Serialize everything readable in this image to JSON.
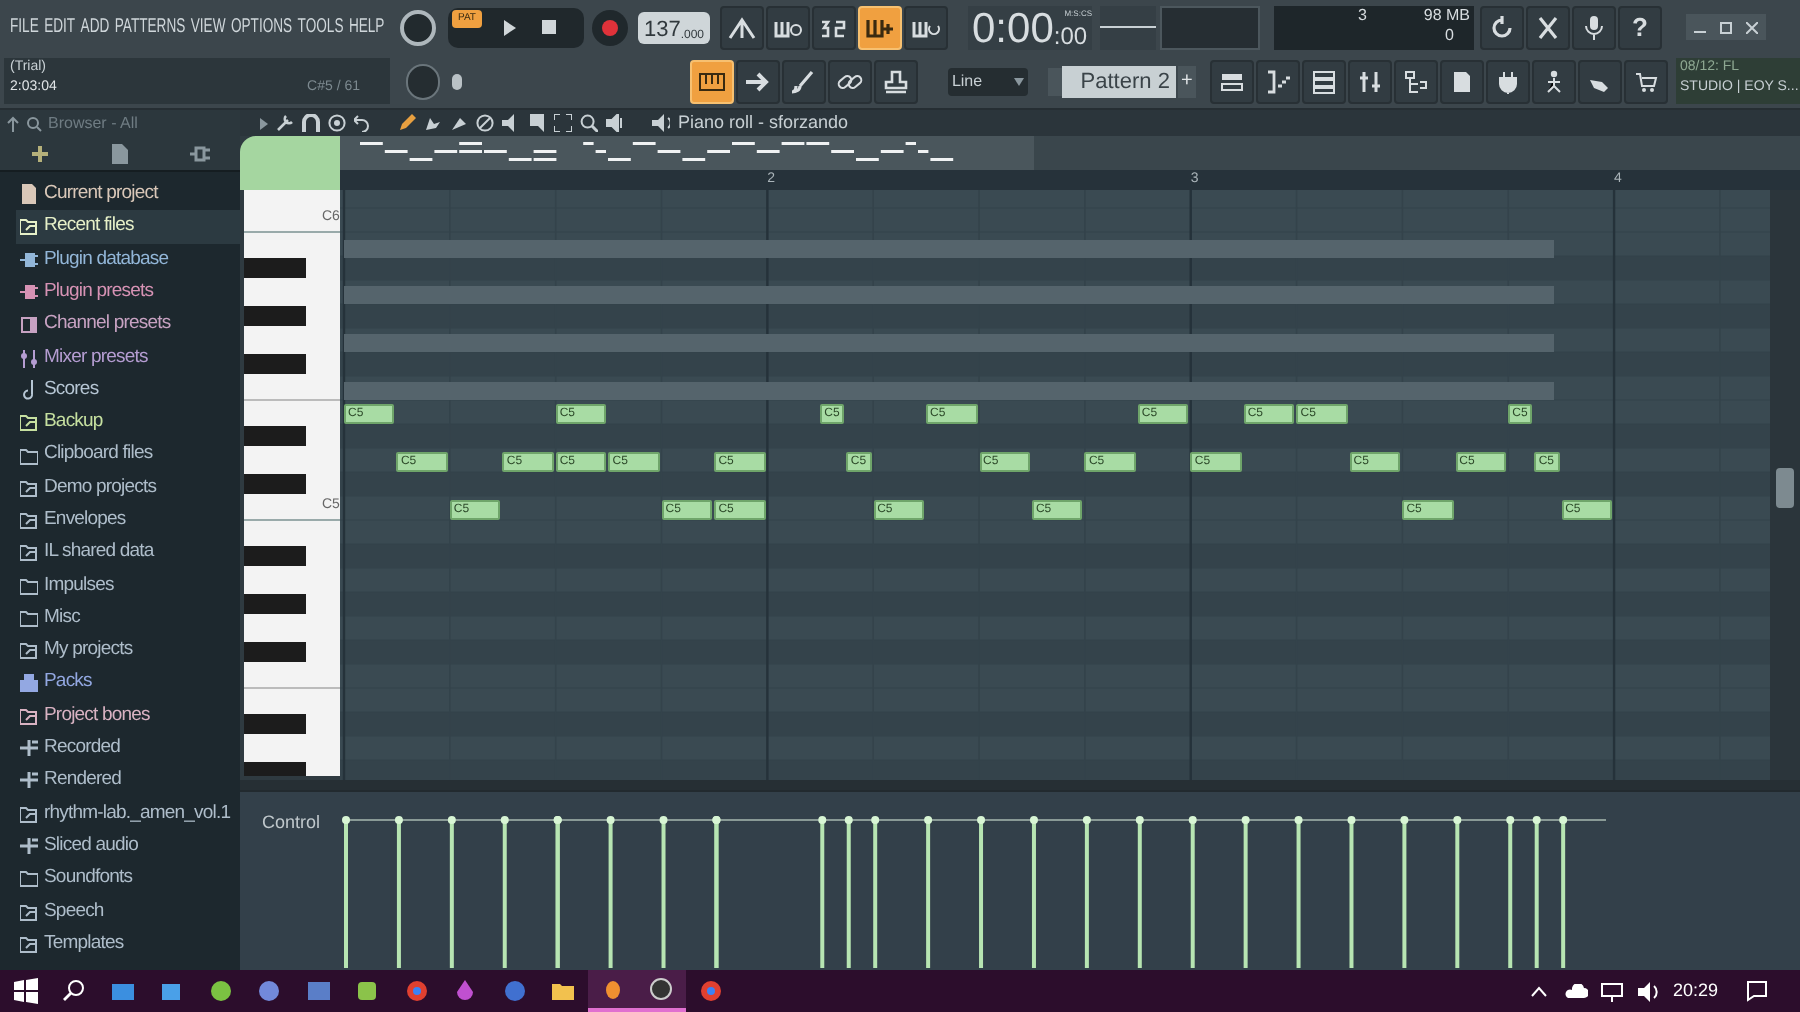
{
  "menu": [
    "FILE",
    "EDIT",
    "ADD",
    "PATTERNS",
    "VIEW",
    "OPTIONS",
    "TOOLS",
    "HELP"
  ],
  "info": {
    "title": "(Trial)",
    "time": "2:03:04",
    "note": "C#5 / 61"
  },
  "transport": {
    "pattern_badge": "PAT",
    "tempo": "137",
    "tempo_fraction": ".000",
    "time": "0:00",
    "time_fraction": ":00",
    "time_unit": "M:S:CS"
  },
  "record_buttons": [
    {
      "kind": "metronome",
      "on": false
    },
    {
      "kind": "wait",
      "on": false
    },
    {
      "kind": "countdown",
      "on": false
    },
    {
      "kind": "step",
      "on": true
    },
    {
      "kind": "loop",
      "on": false
    }
  ],
  "monitor": {
    "cpu": "3",
    "memory": "98 MB",
    "polyphony": "0"
  },
  "help_button": "?",
  "edit_buttons": [
    {
      "kind": "keyboard",
      "on": true
    },
    {
      "kind": "arrow",
      "on": false
    },
    {
      "kind": "brush",
      "on": false
    },
    {
      "kind": "link",
      "on": false
    },
    {
      "kind": "stamp",
      "on": false
    }
  ],
  "snap": "Line",
  "pattern": {
    "name": "Pattern 2",
    "add": "+"
  },
  "news": [
    "08/12: FL",
    "STUDIO | EOY S..."
  ],
  "browser": {
    "title": "Browser - All",
    "items": [
      {
        "label": "Current project",
        "kind": "file",
        "color": "#d9c7b8",
        "selected": false
      },
      {
        "label": "Recent files",
        "kind": "folder-link",
        "color": "#e6f0c8",
        "selected": true
      },
      {
        "label": "Plugin database",
        "kind": "plug",
        "color": "#92b6d8",
        "selected": false
      },
      {
        "label": "Plugin presets",
        "kind": "plug",
        "color": "#d692b4",
        "selected": false
      },
      {
        "label": "Channel presets",
        "kind": "square",
        "color": "#c7a2c2",
        "selected": false
      },
      {
        "label": "Mixer presets",
        "kind": "mixer",
        "color": "#b59dd2",
        "selected": false
      },
      {
        "label": "Scores",
        "kind": "note",
        "color": "#b6c6d4",
        "selected": false
      },
      {
        "label": "Backup",
        "kind": "folder-link",
        "color": "#c6e0a0",
        "selected": false
      },
      {
        "label": "Clipboard files",
        "kind": "folder",
        "color": "#aebdca",
        "selected": false
      },
      {
        "label": "Demo projects",
        "kind": "folder-link",
        "color": "#aebdca",
        "selected": false
      },
      {
        "label": "Envelopes",
        "kind": "folder-link",
        "color": "#aebdca",
        "selected": false
      },
      {
        "label": "IL shared data",
        "kind": "folder-link",
        "color": "#aebdca",
        "selected": false
      },
      {
        "label": "Impulses",
        "kind": "folder",
        "color": "#aebdca",
        "selected": false
      },
      {
        "label": "Misc",
        "kind": "folder",
        "color": "#aebdca",
        "selected": false
      },
      {
        "label": "My projects",
        "kind": "folder-link",
        "color": "#aebdca",
        "selected": false
      },
      {
        "label": "Packs",
        "kind": "pack",
        "color": "#93a8e2",
        "selected": false
      },
      {
        "label": "Project bones",
        "kind": "folder-link",
        "color": "#d8b2c2",
        "selected": false
      },
      {
        "label": "Recorded",
        "kind": "plus",
        "color": "#aebdca",
        "selected": false
      },
      {
        "label": "Rendered",
        "kind": "plus",
        "color": "#aebdca",
        "selected": false
      },
      {
        "label": "rhythm-lab._amen_vol.1",
        "kind": "folder-link",
        "color": "#aebdca",
        "selected": false
      },
      {
        "label": "Sliced audio",
        "kind": "plus",
        "color": "#aebdca",
        "selected": false
      },
      {
        "label": "Soundfonts",
        "kind": "folder",
        "color": "#aebdca",
        "selected": false
      },
      {
        "label": "Speech",
        "kind": "folder-link",
        "color": "#aebdca",
        "selected": false
      },
      {
        "label": "Templates",
        "kind": "folder-link",
        "color": "#aebdca",
        "selected": false
      }
    ]
  },
  "piano_roll": {
    "title": "Piano roll - sforzando",
    "bar_numbers": [
      "2",
      "3",
      "4"
    ],
    "key_labels": [
      "C6",
      "C5"
    ],
    "lanes": [
      {
        "notes": [
          {
            "label": "C5"
          },
          {
            "label": "C5"
          },
          {
            "label": "C5"
          },
          {
            "label": "C5"
          },
          {
            "label": "C5"
          },
          {
            "label": "C5"
          },
          {
            "label": "C5"
          },
          {
            "label": "C5"
          }
        ]
      },
      {
        "notes": [
          {
            "label": "C5"
          },
          {
            "label": "C5"
          },
          {
            "label": "C5"
          },
          {
            "label": "C5"
          },
          {
            "label": "C5"
          },
          {
            "label": "C5"
          },
          {
            "label": "C5"
          },
          {
            "label": "C5"
          },
          {
            "label": "C5"
          },
          {
            "label": "C5"
          },
          {
            "label": "C5"
          },
          {
            "label": "C5"
          }
        ]
      },
      {
        "notes": [
          {
            "label": "C5"
          },
          {
            "label": "C5"
          },
          {
            "label": "C5"
          },
          {
            "label": "C5"
          },
          {
            "label": "C5"
          },
          {
            "label": "C5"
          },
          {
            "label": "C5"
          }
        ]
      }
    ],
    "control_label": "Control"
  },
  "taskbar": {
    "time": "20:29"
  }
}
